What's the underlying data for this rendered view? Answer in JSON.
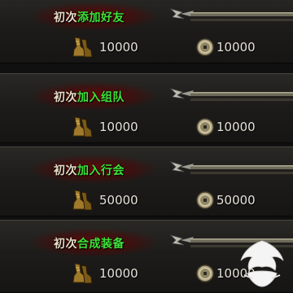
{
  "achievements": [
    {
      "prefix": "初次",
      "action": "添加好友",
      "reward_left": "10000",
      "reward_right": "10000"
    },
    {
      "prefix": "初次",
      "action": "加入组队",
      "reward_left": "10000",
      "reward_right": "10000"
    },
    {
      "prefix": "初次",
      "action": "加入行会",
      "reward_left": "50000",
      "reward_right": "50000"
    },
    {
      "prefix": "初次",
      "action": "合成装备",
      "reward_left": "10000",
      "reward_right": "10000"
    }
  ],
  "icons": {
    "reward_left": "boots-icon",
    "reward_right": "coin-icon",
    "ornament": "sword-bar-ornament",
    "corner": "logo-icon"
  },
  "colors": {
    "action_text": "#3ee23a",
    "prefix_text": "#e8dcc6",
    "title_glow": "#8a0000",
    "value_text": "#e6e2da"
  }
}
